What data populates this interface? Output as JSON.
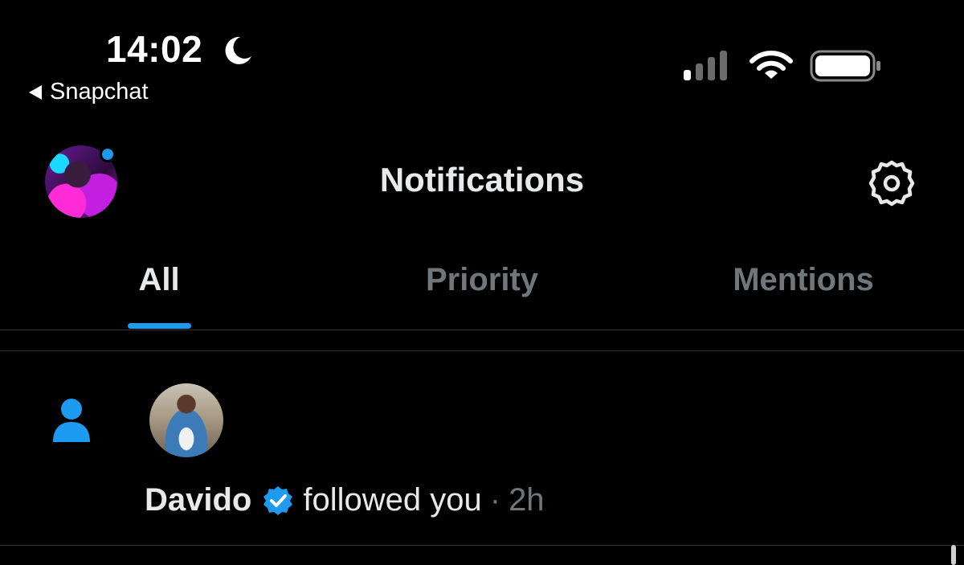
{
  "status_bar": {
    "time": "14:02",
    "back_app": "Snapchat",
    "icons": [
      "moon-icon",
      "signal-icon",
      "wifi-icon",
      "battery-icon"
    ]
  },
  "header": {
    "title": "Notifications",
    "icons": [
      "avatar",
      "gear-icon"
    ]
  },
  "tabs": [
    {
      "label": "All",
      "active": true
    },
    {
      "label": "Priority",
      "active": false
    },
    {
      "label": "Mentions",
      "active": false
    }
  ],
  "notifications": [
    {
      "type_icon": "person-icon",
      "name": "Davido",
      "verified": true,
      "action": "followed you",
      "separator": "·",
      "time": "2h"
    }
  ],
  "colors": {
    "background": "#000000",
    "accent": "#1d9bf0",
    "text_primary": "#e7e9ea",
    "text_secondary": "#71767b",
    "divider": "#2f3336"
  }
}
